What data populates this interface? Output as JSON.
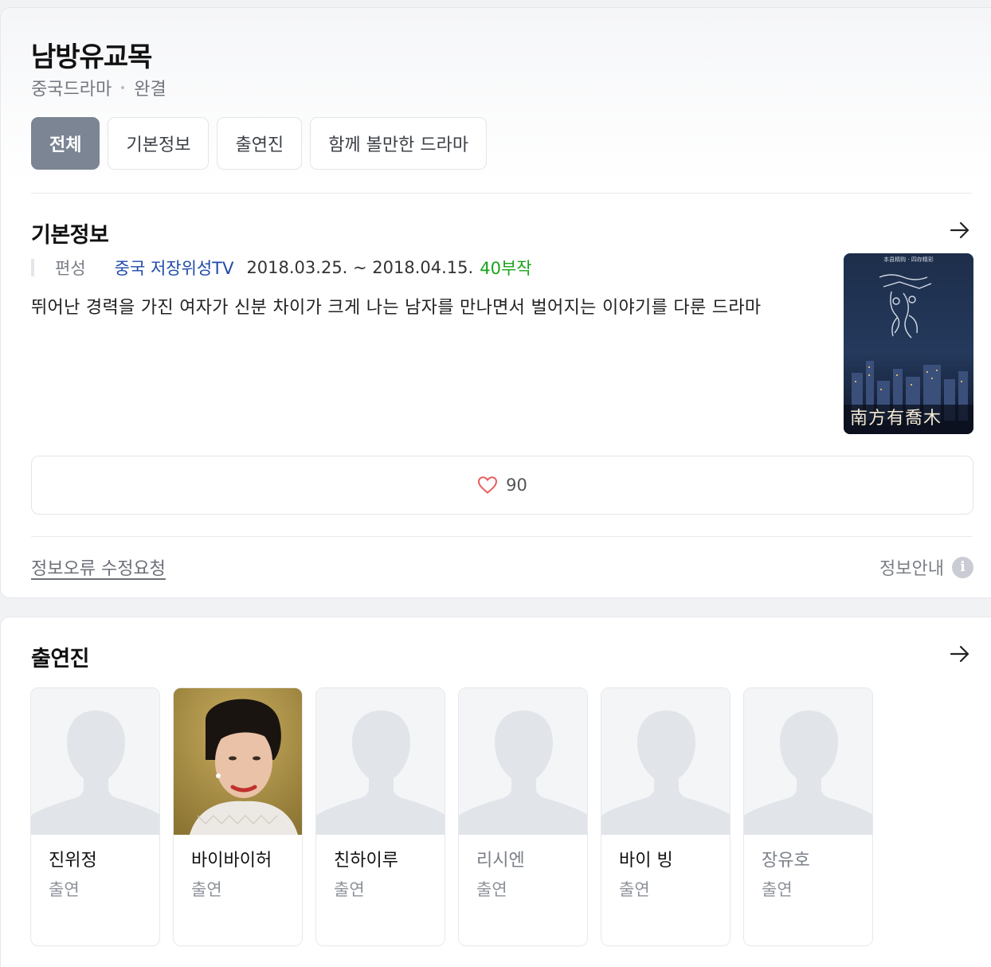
{
  "header": {
    "title": "남방유교목",
    "genre": "중국드라마",
    "status": "완결"
  },
  "tabs": [
    {
      "label": "전체",
      "active": true
    },
    {
      "label": "기본정보",
      "active": false
    },
    {
      "label": "출연진",
      "active": false
    },
    {
      "label": "함께 볼만한 드라마",
      "active": false
    }
  ],
  "basic_info": {
    "section_title": "기본정보",
    "label": "편성",
    "channel": "중국 저장위성TV",
    "dates": "2018.03.25. ~ 2018.04.15.",
    "episodes": "40부작",
    "description": "뛰어난 경력을 가진 여자가 신분 차이가 크게 나는 남자를 만나면서 벌어지는 이야기를 다룬 드라마",
    "poster_caption": "南方有喬木",
    "poster_topline": "本县精购 · 四存精彩"
  },
  "like": {
    "count": "90",
    "icon": "heart-outline-icon",
    "color": "#e85a5a"
  },
  "footer": {
    "report_label": "정보오류 수정요청",
    "info_label": "정보안내",
    "info_icon_glyph": "i"
  },
  "cast": {
    "section_title": "출연진",
    "members": [
      {
        "name": "진위정",
        "role": "출연",
        "photo": "placeholder"
      },
      {
        "name": "바이바이허",
        "role": "출연",
        "photo": "portrait"
      },
      {
        "name": "친하이루",
        "role": "출연",
        "photo": "placeholder"
      },
      {
        "name": "리시엔",
        "role": "출연",
        "photo": "placeholder"
      },
      {
        "name": "바이 빙",
        "role": "출연",
        "photo": "placeholder"
      },
      {
        "name": "장유호",
        "role": "출연",
        "photo": "placeholder"
      }
    ]
  },
  "colors": {
    "active_tab": "#7b8593",
    "channel_link": "#1f4aa8",
    "episodes": "#1aa21a"
  }
}
